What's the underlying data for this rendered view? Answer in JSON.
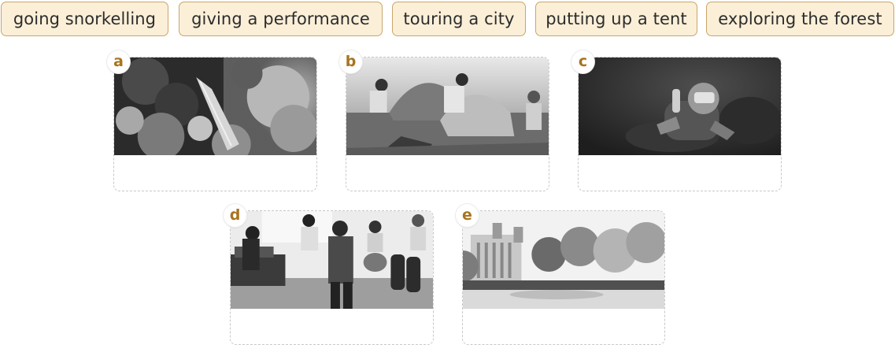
{
  "word_bank": [
    "going snorkelling",
    "giving a performance",
    "touring a city",
    "putting up a tent",
    "exploring the forest"
  ],
  "cards": [
    {
      "letter": "a",
      "icon": "forest-photo"
    },
    {
      "letter": "b",
      "icon": "tent-photo"
    },
    {
      "letter": "c",
      "icon": "snorkelling-photo"
    },
    {
      "letter": "d",
      "icon": "performance-photo"
    },
    {
      "letter": "e",
      "icon": "city-photo"
    }
  ]
}
